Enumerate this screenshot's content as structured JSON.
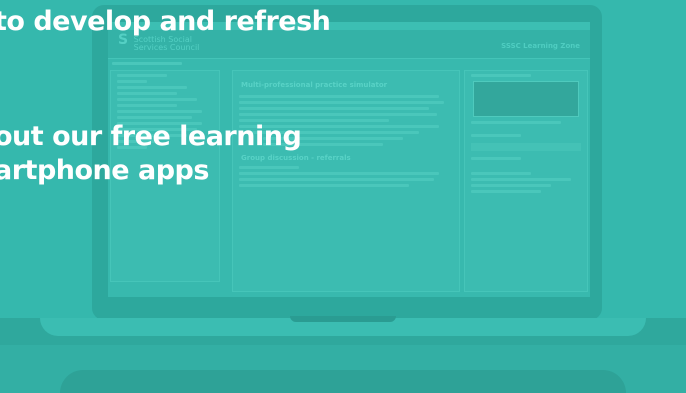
{
  "hero": {
    "line1": "to develop and refresh",
    "line2": "out our free learning",
    "line3": "artphone apps"
  },
  "site": {
    "logo_mark": "S",
    "logo_line1": "Scottish Social",
    "logo_line2": "Services Council",
    "brand": "SSSC Learning Zone",
    "main_title": "Multi-professional practice simulator",
    "section_title": "Group discussion - referrals"
  },
  "icons": {
    "laptop": "laptop-device"
  }
}
